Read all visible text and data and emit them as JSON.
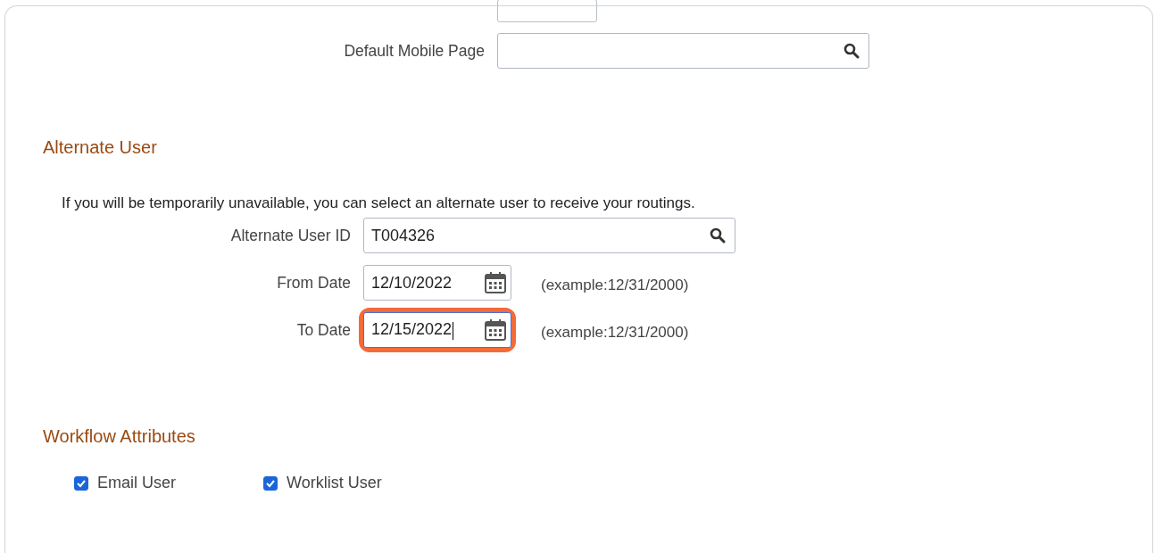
{
  "default_mobile_page": {
    "label": "Default Mobile Page"
  },
  "alternate_user": {
    "heading": "Alternate User",
    "info": "If you will be temporarily unavailable, you can select an alternate user to receive your routings.",
    "user_id": {
      "label": "Alternate User ID",
      "value": "T004326"
    },
    "dates": [
      {
        "label": "From Date",
        "value": "12/10/2022",
        "hint": "(example:12/31/2000)",
        "focused": false,
        "highlighted": false
      },
      {
        "label": "To Date",
        "value": "12/15/2022",
        "hint": "(example:12/31/2000)",
        "focused": true,
        "highlighted": true
      }
    ]
  },
  "workflow_attributes": {
    "heading": "Workflow Attributes",
    "options": [
      {
        "label": "Email User",
        "checked": true
      },
      {
        "label": "Worklist User",
        "checked": true
      }
    ]
  }
}
